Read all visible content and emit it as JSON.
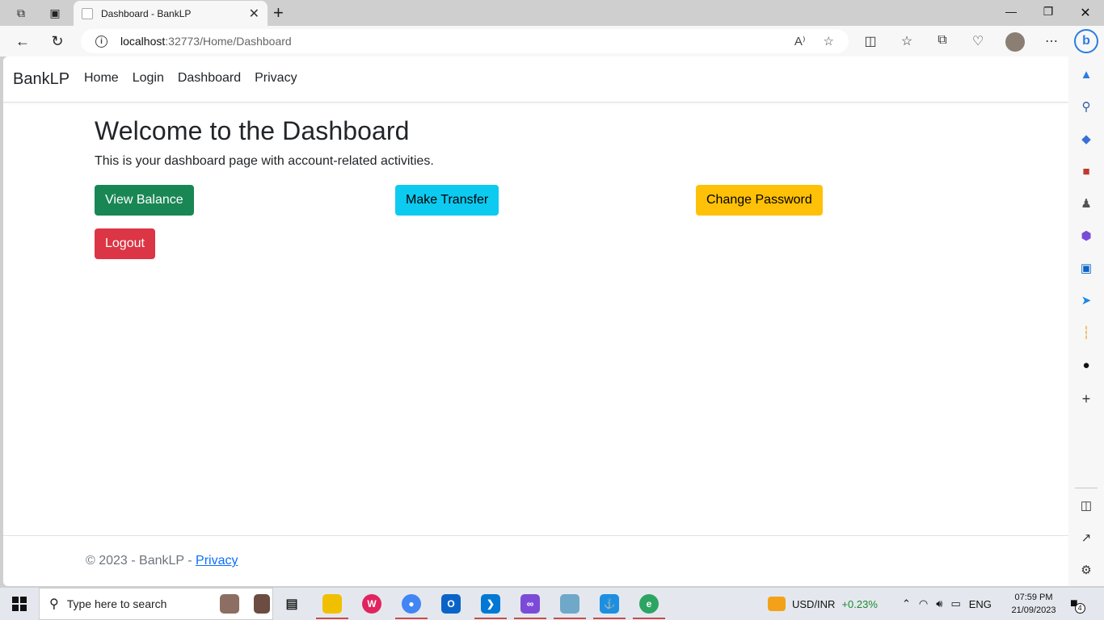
{
  "browser": {
    "tab_title": "Dashboard - BankLP",
    "url_host": "localhost",
    "url_path": ":32773/Home/Dashboard",
    "read_aloud_label": "A⁾"
  },
  "navbar": {
    "brand": "BankLP",
    "links": [
      "Home",
      "Login",
      "Dashboard",
      "Privacy"
    ]
  },
  "main": {
    "title": "Welcome to the Dashboard",
    "subtitle": "This is your dashboard page with account-related activities.",
    "buttons": {
      "view_balance": "View Balance",
      "make_transfer": "Make Transfer",
      "change_password": "Change Password",
      "logout": "Logout"
    }
  },
  "footer": {
    "copyright": "© 2023 - BankLP - ",
    "privacy_link": "Privacy"
  },
  "taskbar": {
    "search_placeholder": "Type here to search",
    "currency": "USD/INR",
    "currency_change": "+0.23%",
    "language": "ENG",
    "time": "07:59 PM",
    "date": "21/09/2023",
    "notification_count": "4"
  },
  "colors": {
    "success": "#198754",
    "info": "#0dcaf0",
    "warning": "#ffc107",
    "danger": "#dc3545",
    "link": "#0d6efd",
    "currency_up": "#1a8a2e"
  }
}
